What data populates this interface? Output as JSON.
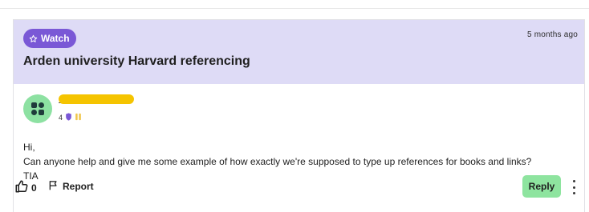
{
  "post": {
    "watch_label": "Watch",
    "timestamp": "5 months ago",
    "title": "Arden university Harvard referencing",
    "author": {
      "stat_number": "4"
    },
    "body": {
      "line1": "Hi,",
      "line2": "Can anyone help and give me some example of how exactly we're supposed to type up references for books and links?",
      "line3": "TIA"
    },
    "actions": {
      "like_count": "0",
      "report_label": "Report",
      "reply_label": "Reply"
    }
  },
  "colors": {
    "header_bg": "#dedbf6",
    "watch_bg": "#7a58d6",
    "reply_bg": "#8ee49f",
    "avatar_bg": "#8de1a2",
    "redaction": "#f5c400"
  },
  "icons": [
    "star-icon",
    "thumbs-up-icon",
    "flag-icon",
    "more-vertical-icon",
    "shield-icon",
    "badge-icon"
  ]
}
